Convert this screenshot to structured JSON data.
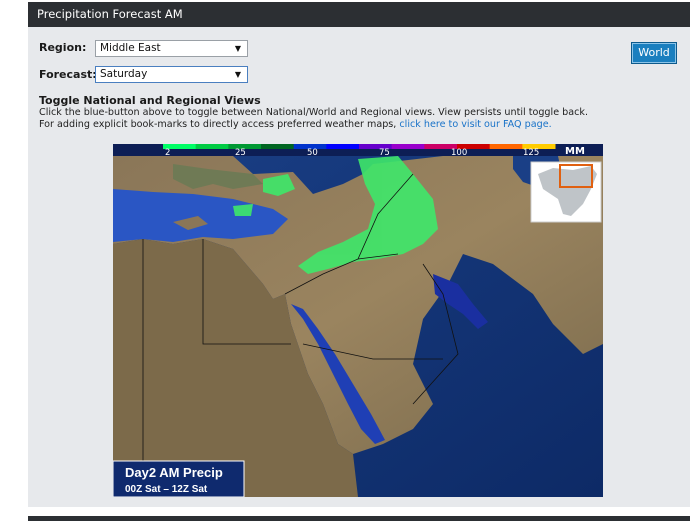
{
  "header": {
    "title": "Precipitation Forecast AM"
  },
  "region": {
    "label": "Region:",
    "value": "Middle East"
  },
  "forecast": {
    "label": "Forecast:",
    "value": "Saturday"
  },
  "world_button": {
    "label": "World"
  },
  "toggle": {
    "title": "Toggle National and Regional Views",
    "line1": "Click the blue-button above to toggle between National/World and Regional views. View persists until toggle back.",
    "line2_prefix": "For adding explicit book-marks to directly access preferred weather maps, ",
    "line2_link": "click here to visit our FAQ page."
  },
  "map": {
    "scale_ticks": [
      "2",
      "25",
      "50",
      "75",
      "100",
      "125"
    ],
    "scale_unit": "MM",
    "scale_colors": [
      "#00ff66",
      "#00cc44",
      "#009933",
      "#006622",
      "#0033cc",
      "#0000ff",
      "#6600cc",
      "#9900cc",
      "#cc0066",
      "#cc0000",
      "#ff6600",
      "#ffcc00"
    ],
    "caption_title": "Day2 AM Precip",
    "caption_time": "00Z Sat – 12Z Sat"
  },
  "colors": {
    "header_bg": "#2c2f33",
    "panel_bg": "#e7e9ec",
    "button_bg": "#1a7fbf",
    "link": "#1a73c8"
  }
}
